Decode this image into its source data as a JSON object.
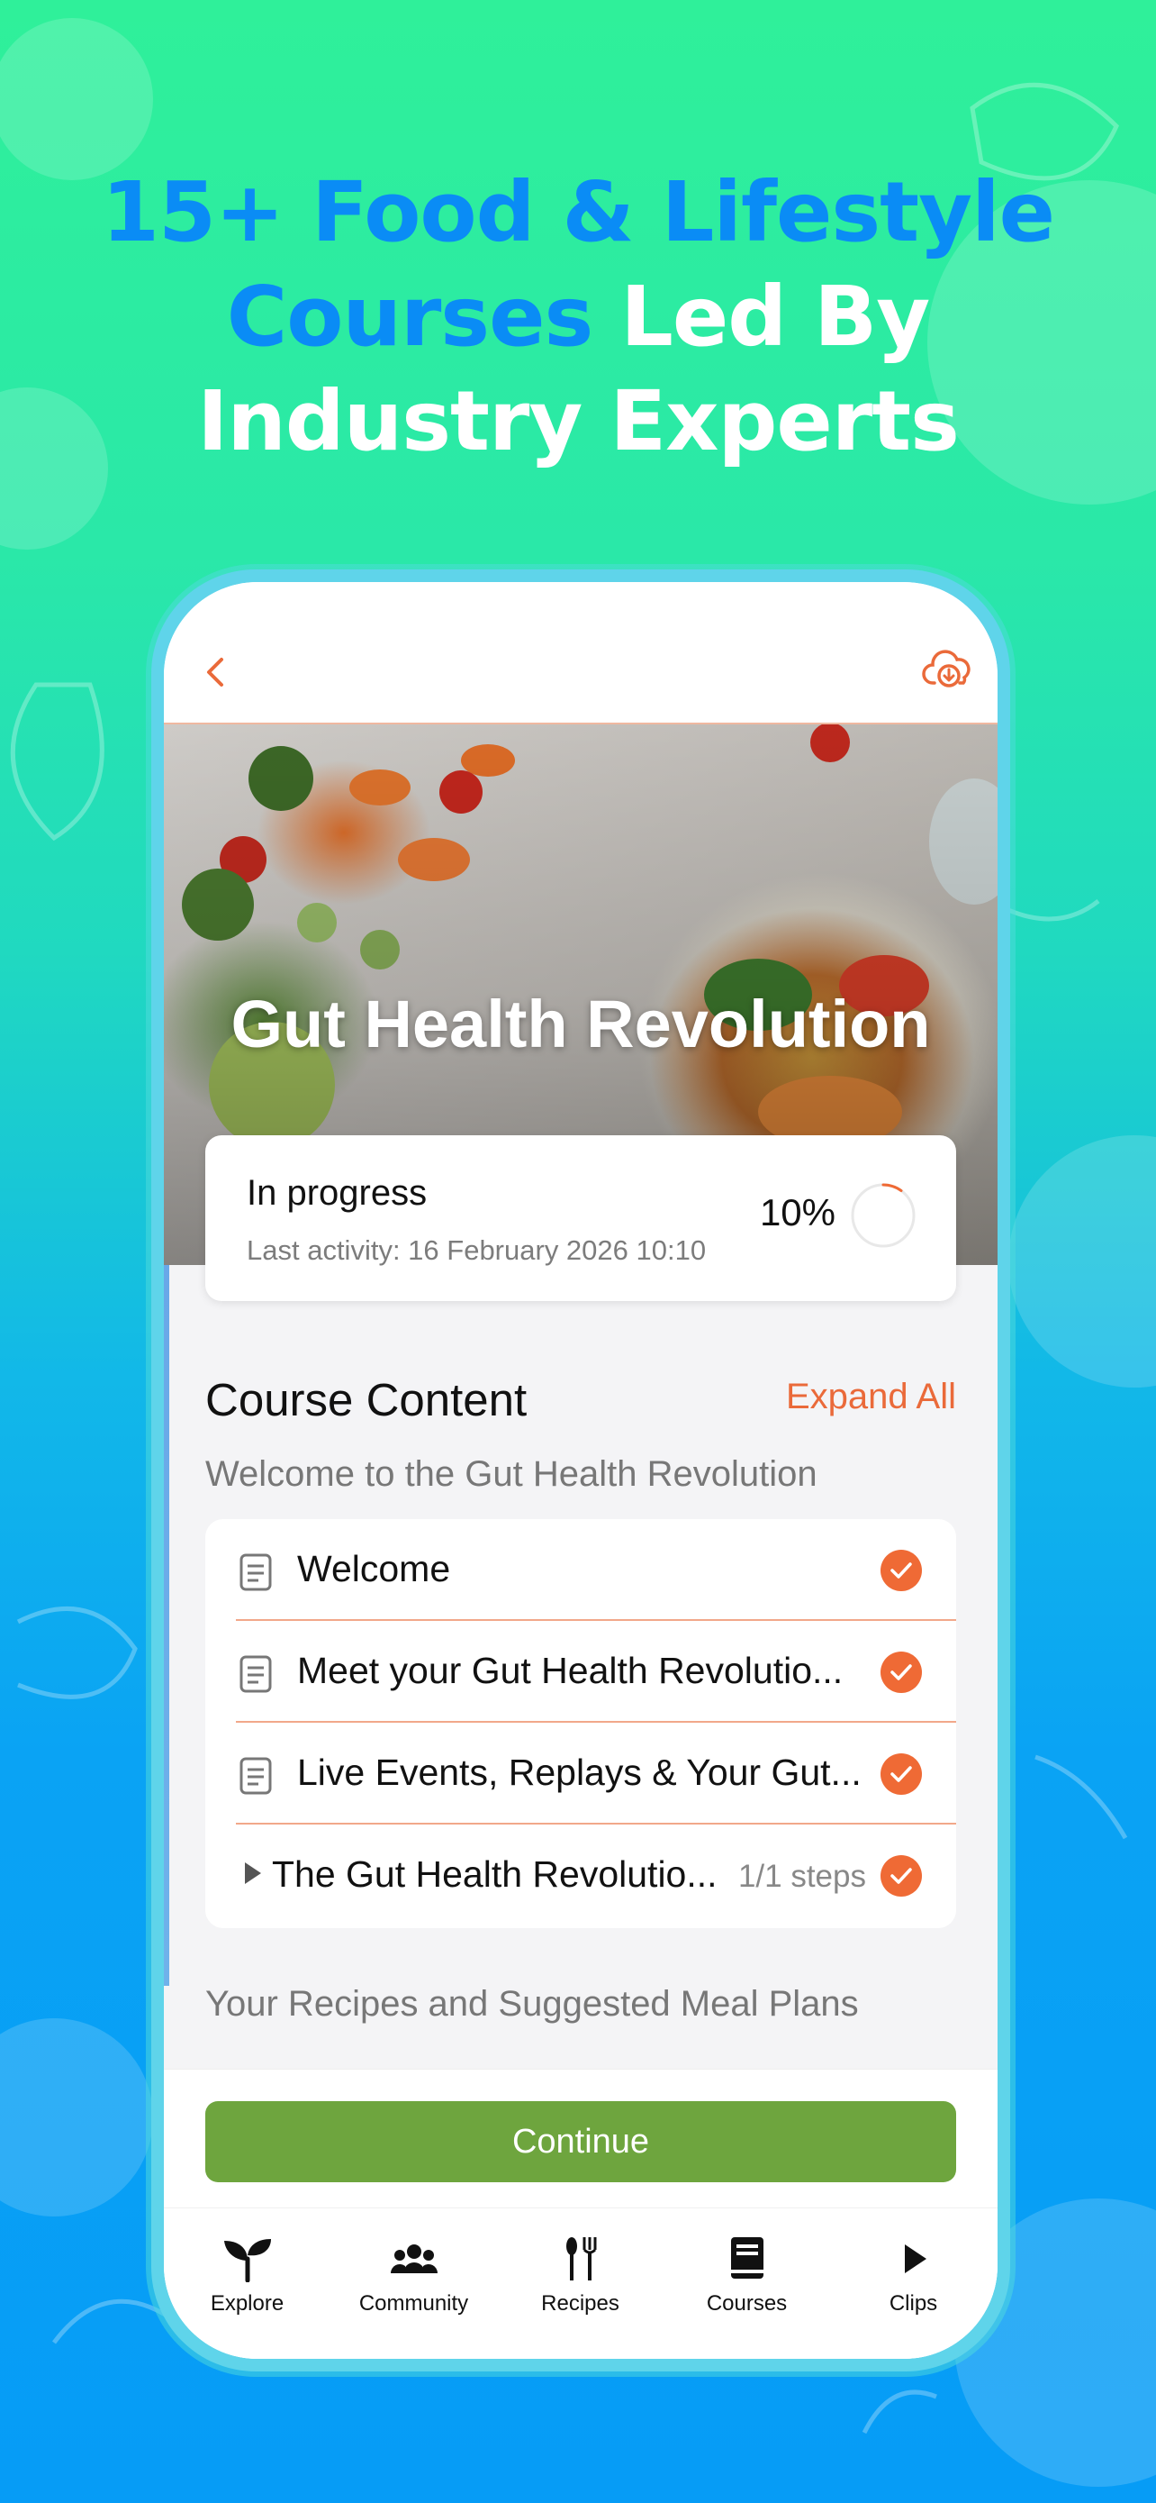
{
  "marketing": {
    "headline_line1_blue": "15+ Food & Lifestyle",
    "headline_line2_blue": "Courses",
    "headline_line2_white": " Led By",
    "headline_line3_white": "Industry Experts"
  },
  "colors": {
    "accent": "#ef6a35",
    "primary_button": "#6ea53e",
    "headline_blue": "#0a8cf5"
  },
  "topbar": {
    "back_icon": "chevron-left-icon",
    "download_icon": "cloud-download-icon"
  },
  "course": {
    "title": "Gut Health Revolution",
    "status": "In progress",
    "last_activity": "Last activity:  16 February 2026 10:10",
    "progress_label": "10%",
    "progress_fraction": 0.1
  },
  "content": {
    "heading": "Course Content",
    "expand_label": "Expand All",
    "sections": [
      {
        "title": "Welcome to the Gut Health Revolution",
        "lessons": [
          {
            "label": "Welcome",
            "completed": true
          },
          {
            "label": "Meet your Gut Health Revolutio...",
            "completed": true
          },
          {
            "label": "Live Events, Replays & Your Gut...",
            "completed": true
          },
          {
            "label": "The Gut Health Revolutio...",
            "steps": "1/1 steps",
            "completed": true
          }
        ]
      },
      {
        "title": "Your Recipes and Suggested Meal Plans"
      }
    ]
  },
  "actions": {
    "continue_label": "Continue"
  },
  "tabs": [
    {
      "label": "Explore",
      "icon": "sprout-icon"
    },
    {
      "label": "Community",
      "icon": "people-icon"
    },
    {
      "label": "Recipes",
      "icon": "utensils-icon"
    },
    {
      "label": "Courses",
      "icon": "book-icon"
    },
    {
      "label": "Clips",
      "icon": "play-icon"
    }
  ]
}
